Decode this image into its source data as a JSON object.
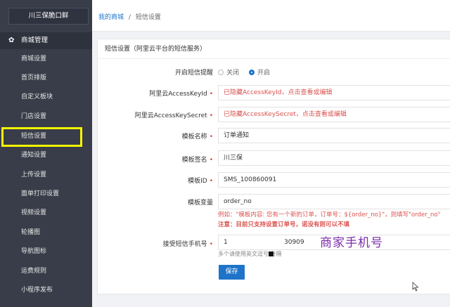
{
  "sidebar": {
    "brand": "川三保脆口鲜",
    "section": "商城管理",
    "items": [
      "商城设置",
      "首页排版",
      "自定义板块",
      "门店设置",
      "短信设置",
      "通知设置",
      "上传设置",
      "面单打印设置",
      "视频设置",
      "轮播图",
      "导航图标",
      "运费规则",
      "小程序发布"
    ]
  },
  "breadcrumb": {
    "home": "我的商城",
    "sep": "/",
    "current": "短信设置"
  },
  "card": {
    "title": "短信设置（阿里云平台的短信服务）",
    "toggle": {
      "label": "开启短信提醒",
      "off": "关闭",
      "on": "开启"
    },
    "access_key_id": {
      "label": "阿里云AccessKeyId",
      "placeholder": "已隐藏AccessKeyId，点击查看或编辑"
    },
    "access_key_secret": {
      "label": "阿里云AccessKeySecret",
      "placeholder": "已隐藏AccessKeySecret，点击查看或编辑"
    },
    "template_name": {
      "label": "模板名称",
      "value": "订单通知"
    },
    "template_sign": {
      "label": "模板签名",
      "value": "川三保"
    },
    "template_id": {
      "label": "模板ID",
      "value": "SMS_100860091"
    },
    "template_var": {
      "label": "模板变量",
      "value": "order_no",
      "example": "例如：\"模板内容: 您有一个新的订单，订单号：${order_no}\"，则填写\"order_no\"",
      "note": "注意：目前只支持设置订单号，诺没有则可以不填"
    },
    "phone": {
      "label": "接受短信手机号",
      "value_start": "1",
      "value_end": "30909",
      "tip": "多个请使用英文逗号     分隔"
    },
    "save": "保存"
  },
  "annotation": "商家手机号",
  "colors": {
    "accent": "#1f74c9",
    "highlight": "#f5f500",
    "sidebar": "#393d49"
  }
}
